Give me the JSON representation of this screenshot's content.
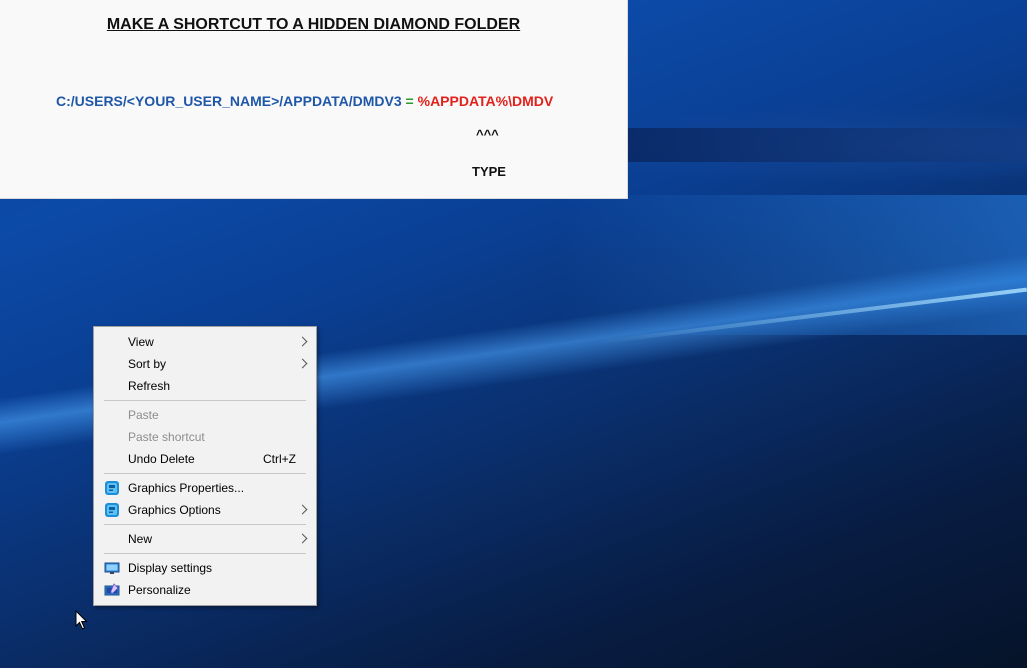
{
  "note": {
    "title": "MAKE A SHORTCUT TO A HIDDEN DIAMOND FOLDER",
    "path": "C:/USERS/<YOUR_USER_NAME>/APPDATA/DMDV3",
    "equals": "=",
    "env_path": "%APPDATA%\\DMDV",
    "carets": "^^^",
    "type_label": "TYPE",
    "colors": {
      "path": "#1f57a8",
      "equals": "#2d9a2d",
      "env_path": "#e3211c"
    }
  },
  "context_menu": {
    "view": "View",
    "sort_by": "Sort by",
    "refresh": "Refresh",
    "paste": "Paste",
    "paste_shortcut": "Paste shortcut",
    "undo_delete": "Undo Delete",
    "undo_delete_shortcut": "Ctrl+Z",
    "graphics_properties": "Graphics Properties...",
    "graphics_options": "Graphics Options",
    "new": "New",
    "display_settings": "Display settings",
    "personalize": "Personalize"
  },
  "icons": {
    "graphics_properties": "intel-graphics-icon",
    "graphics_options": "intel-graphics-icon",
    "display_settings": "monitor-icon",
    "personalize": "personalize-icon",
    "submenu": "chevron-right-icon",
    "pointer": "mouse-cursor-icon"
  }
}
